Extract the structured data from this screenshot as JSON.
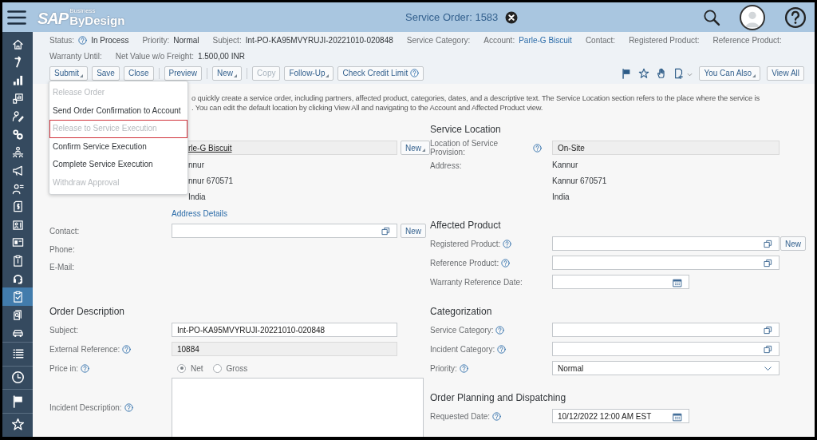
{
  "header": {
    "logo": "SAP",
    "logo_super": "Business",
    "logo_name": "ByDesign",
    "title": "Service Order: 1583"
  },
  "sidebar": {
    "items": [
      {
        "selected": false
      },
      {
        "selected": false
      },
      {
        "selected": false
      },
      {
        "selected": false
      },
      {
        "selected": false
      },
      {
        "selected": false
      },
      {
        "selected": false
      },
      {
        "selected": false
      },
      {
        "selected": false
      },
      {
        "selected": false
      },
      {
        "selected": false
      },
      {
        "selected": false
      },
      {
        "selected": false
      },
      {
        "selected": false
      },
      {
        "selected": true
      },
      {
        "selected": false
      },
      {
        "selected": false
      }
    ],
    "bottom": [
      {
        "selected": false
      },
      {
        "selected": false
      },
      {
        "selected": false
      },
      {
        "selected": false
      }
    ]
  },
  "facts": [
    [
      {
        "label": "Status:",
        "help": true,
        "value": "In Process"
      },
      {
        "label": "Priority:",
        "value": "Normal"
      },
      {
        "label": "Subject:",
        "value": "Int-PO-KA95MVYRUJI-20221010-020848"
      },
      {
        "label": "Service Category:"
      },
      {
        "label": "Account:",
        "value": "Parle-G Biscuit",
        "link": true
      },
      {
        "label": "Contact:"
      },
      {
        "label": "Registered Product:"
      },
      {
        "label": "Reference Product:"
      }
    ],
    [
      {
        "label": "Warranty Until:"
      },
      {
        "label": "Net Value w/o Freight:",
        "value": "1.500,00 INR"
      }
    ]
  ],
  "toolbar": {
    "left": [
      {
        "kind": "button",
        "label": "Submit",
        "menu": true,
        "disabled": false
      },
      {
        "kind": "button",
        "label": "Save",
        "menu": false,
        "disabled": false
      },
      {
        "kind": "button",
        "label": "Close",
        "menu": false,
        "disabled": false
      },
      {
        "kind": "separator"
      },
      {
        "kind": "button",
        "label": "Preview",
        "menu": false,
        "disabled": false
      },
      {
        "kind": "separator"
      },
      {
        "kind": "button",
        "label": "New",
        "menu": true,
        "disabled": false
      },
      {
        "kind": "separator"
      },
      {
        "kind": "button",
        "label": "Copy",
        "menu": false,
        "disabled": true
      },
      {
        "kind": "button",
        "label": "Follow-Up",
        "menu": true,
        "disabled": false
      },
      {
        "kind": "button",
        "label": "Check Credit Limit",
        "menu": false,
        "disabled": false,
        "help": true
      }
    ],
    "right": [
      {
        "kind": "icon"
      },
      {
        "kind": "icon"
      },
      {
        "kind": "icon"
      },
      {
        "kind": "icon",
        "chevron": true
      },
      {
        "kind": "button",
        "label": "You Can Also",
        "menu": true,
        "disabled": false
      },
      {
        "kind": "button",
        "label": "View All",
        "menu": false,
        "disabled": false
      }
    ]
  },
  "menu": [
    {
      "label": "Release Order",
      "disabled": true,
      "highlighted": false
    },
    {
      "label": "Send Order Confirmation to Account",
      "disabled": false,
      "highlighted": false
    },
    {
      "label": "Release to Service Execution",
      "disabled": true,
      "highlighted": true
    },
    {
      "label": "Confirm Service Execution",
      "disabled": false,
      "highlighted": false
    },
    {
      "label": "Complete Service Execution",
      "disabled": false,
      "highlighted": false
    },
    {
      "label": "Withdraw Approval",
      "disabled": true,
      "highlighted": false
    }
  ],
  "intro_lines": [
    "o quickly create a service order, including partners, affected product, categories, dates, and a descriptive text. The Service Location section refers to the place where the service is",
    ". You can edit the default location by clicking View All and navigating to the Account and Affected Product view."
  ],
  "form_rows": [
    [
      [
        {
          "rows": [
            {
              "kind": "field",
              "value": "rle-G Biscuit",
              "link": true,
              "readonly": true,
              "button": "New",
              "button_menu": true
            },
            {
              "kind": "lines",
              "lines": [
                "nnur",
                "nnur 670571",
                "India"
              ]
            }
          ]
        }
      ],
      [
        {
          "heading": "Service Location",
          "rows": [
            {
              "kind": "field",
              "label": "Location of Service Provision:",
              "help": true,
              "value": "On-Site",
              "readonly": true
            },
            {
              "kind": "lines",
              "label": "Address:",
              "lines": [
                "Kannur",
                "Kannur 670571",
                "India"
              ]
            }
          ]
        }
      ]
    ],
    [
      [
        {
          "rows": [
            {
              "kind": "link",
              "text": "Address Details"
            },
            {
              "kind": "lookup-field",
              "label": "Contact:",
              "button": "New"
            },
            {
              "kind": "label",
              "label": "Phone:"
            },
            {
              "kind": "label",
              "label": "E-Mail:"
            }
          ]
        }
      ],
      [
        {
          "heading": "Affected Product",
          "rows": [
            {
              "kind": "lookup-field",
              "label": "Registered Product:",
              "help": true,
              "button": "New"
            },
            {
              "kind": "lookup-field",
              "label": "Reference Product:",
              "help": true
            },
            {
              "kind": "date-field",
              "label": "Warranty Reference Date:"
            }
          ]
        }
      ]
    ],
    [
      [
        {
          "heading": "Order Description",
          "rows": [
            {
              "kind": "field",
              "label": "Subject:",
              "value": "Int-PO-KA95MVYRUJI-20221010-020848"
            },
            {
              "kind": "field",
              "label": "External Reference:",
              "help": true,
              "value": "10884",
              "readonly": true
            },
            {
              "kind": "radio",
              "label": "Price in:",
              "help": true,
              "options": [
                {
                  "label": "Net",
                  "selected": true
                },
                {
                  "label": "Gross",
                  "selected": false
                }
              ]
            },
            {
              "kind": "textarea",
              "label": "Incident Description:",
              "help": true
            }
          ]
        }
      ],
      [
        {
          "heading": "Categorization",
          "rows": [
            {
              "kind": "lookup-field",
              "label": "Service Category:",
              "help": true
            },
            {
              "kind": "lookup-field",
              "label": "Incident Category:",
              "help": true
            },
            {
              "kind": "dropdown",
              "label": "Priority:",
              "help": true,
              "value": "Normal"
            }
          ]
        },
        {
          "heading": "Order Planning and Dispatching",
          "rows": [
            {
              "kind": "date-field",
              "label": "Requested Date:",
              "help": true,
              "value": "10/12/2022 12:00 AM EST"
            }
          ]
        }
      ]
    ]
  ]
}
